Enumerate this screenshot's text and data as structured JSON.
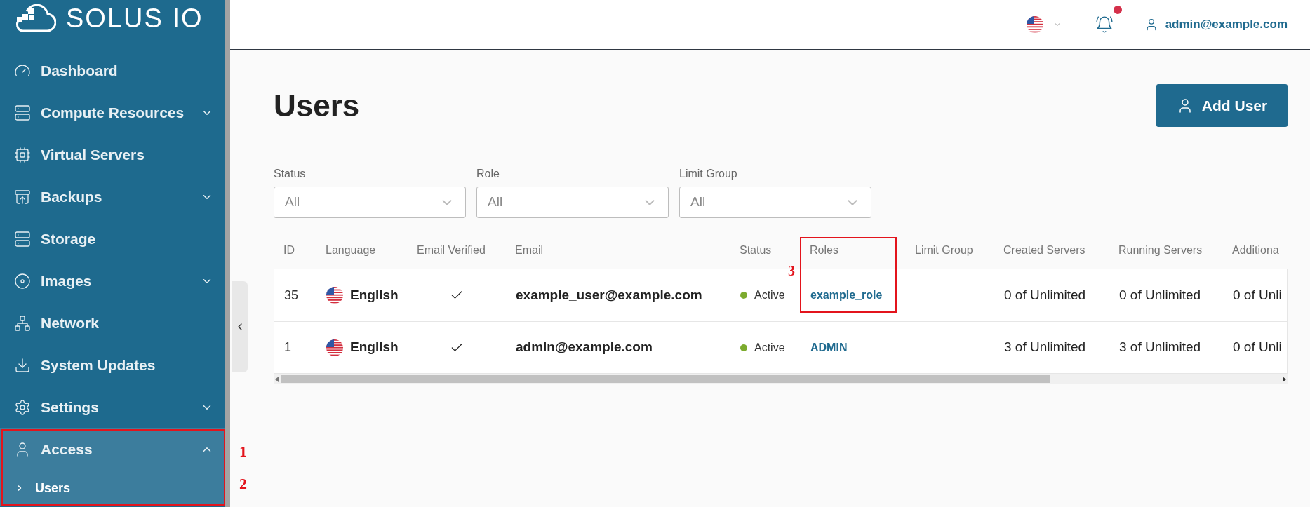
{
  "sidebar": {
    "logo_text": "SOLUS IO",
    "items": [
      {
        "label": "Dashboard",
        "kind": "link"
      },
      {
        "label": "Compute Resources",
        "kind": "group",
        "expanded": false
      },
      {
        "label": "Virtual Servers",
        "kind": "link"
      },
      {
        "label": "Backups",
        "kind": "group",
        "expanded": false
      },
      {
        "label": "Storage",
        "kind": "link"
      },
      {
        "label": "Images",
        "kind": "group",
        "expanded": false
      },
      {
        "label": "Network",
        "kind": "link"
      },
      {
        "label": "System Updates",
        "kind": "link"
      },
      {
        "label": "Settings",
        "kind": "group",
        "expanded": false
      },
      {
        "label": "Access",
        "kind": "group",
        "expanded": true,
        "children": [
          {
            "label": "Users",
            "selected": true
          }
        ]
      }
    ]
  },
  "header": {
    "has_notification": true,
    "user": "admin@example.com"
  },
  "page": {
    "title": "Users",
    "add_button": "Add User"
  },
  "filters": [
    {
      "label": "Status",
      "value": "All"
    },
    {
      "label": "Role",
      "value": "All"
    },
    {
      "label": "Limit Group",
      "value": "All"
    }
  ],
  "table": {
    "columns": [
      "ID",
      "Language",
      "Email Verified",
      "Email",
      "Status",
      "Roles",
      "Limit Group",
      "Created Servers",
      "Running Servers",
      "Additiona"
    ],
    "rows": [
      {
        "id": "35",
        "language": "English",
        "email_verified": true,
        "email": "example_user@example.com",
        "status": "Active",
        "color": "#7cab2e",
        "role": "example_role",
        "created_servers": "0 of Unlimited",
        "running_servers": "0 of Unlimited",
        "column_10": "0 of Unli"
      },
      {
        "id": "1",
        "language": "English",
        "email_verified": true,
        "email": "admin@example.com",
        "status": "Active",
        "color": "#7cab2e",
        "role": "ADMIN",
        "created_servers": "3 of Unlimited",
        "running_servers": "3 of Unlimited",
        "column_10": "0 of Unli"
      }
    ]
  },
  "annotations": [
    "1",
    "2",
    "3"
  ]
}
